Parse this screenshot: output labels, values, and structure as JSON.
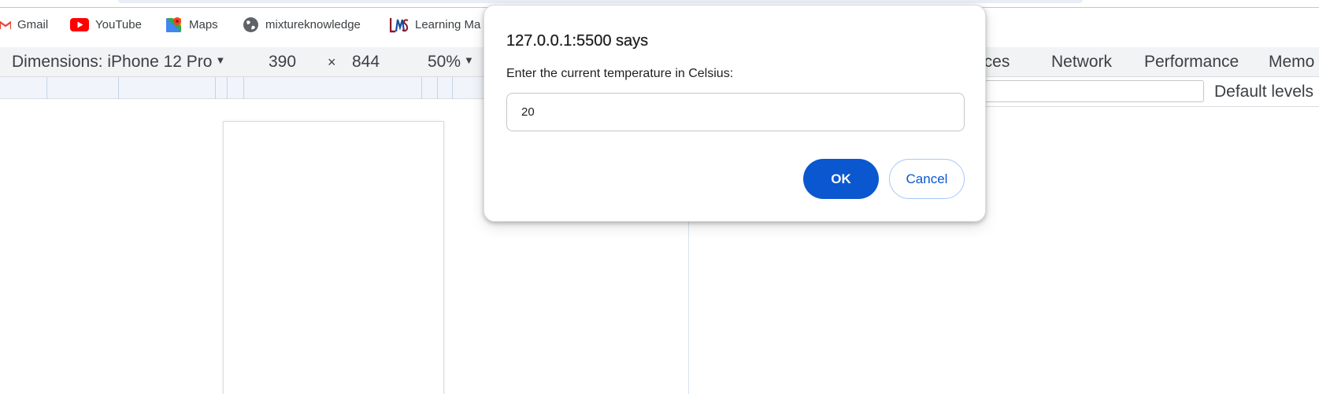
{
  "bookmarks": [
    {
      "label": "Gmail",
      "icon": "gmail-icon"
    },
    {
      "label": "YouTube",
      "icon": "youtube-icon"
    },
    {
      "label": "Maps",
      "icon": "maps-icon"
    },
    {
      "label": "mixtureknowledge",
      "icon": "globe-icon"
    },
    {
      "label": "Learning Ma",
      "icon": "lms-icon"
    }
  ],
  "device_toolbar": {
    "dimensions_label": "Dimensions: iPhone 12 Pro",
    "width": "390",
    "times": "×",
    "height": "844",
    "zoom": "50%"
  },
  "devtools_tabs": [
    "urces",
    "Network",
    "Performance",
    "Memo"
  ],
  "console": {
    "levels_label": "Default levels"
  },
  "dialog": {
    "title": "127.0.0.1:5500 says",
    "message": "Enter the current temperature in Celsius:",
    "input_value": "20",
    "ok_label": "OK",
    "cancel_label": "Cancel"
  },
  "colors": {
    "accent": "#0b57d0",
    "youtube_red": "#ff0000",
    "gmail_red": "#ea4335"
  }
}
